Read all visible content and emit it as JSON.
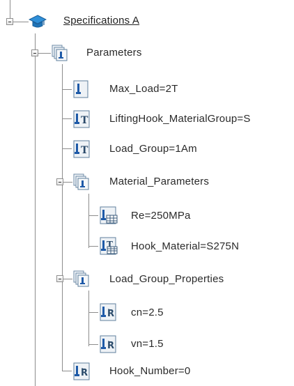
{
  "tree": {
    "root": {
      "label": "Specifications A",
      "icon": "specifications-cap-icon"
    },
    "parameters": {
      "label": "Parameters",
      "icon": "parameter-set-icon"
    },
    "max_load": {
      "label": "Max_Load=2T",
      "icon": "parameter-icon"
    },
    "lifting_hook_material_group": {
      "label": "LiftingHook_MaterialGroup=S",
      "icon": "text-parameter-icon"
    },
    "load_group": {
      "label": "Load_Group=1Am",
      "icon": "text-parameter-icon"
    },
    "material_parameters": {
      "label": "Material_Parameters",
      "icon": "parameter-set-icon"
    },
    "re": {
      "label": "Re=250MPa",
      "icon": "table-parameter-icon"
    },
    "hook_material": {
      "label": "Hook_Material=S275N",
      "icon": "text-table-parameter-icon"
    },
    "load_group_properties": {
      "label": "Load_Group_Properties",
      "icon": "parameter-set-icon"
    },
    "cn": {
      "label": "cn=2.5",
      "icon": "real-parameter-icon"
    },
    "vn": {
      "label": "vn=1.5",
      "icon": "real-parameter-icon"
    },
    "hook_number": {
      "label": "Hook_Number=0",
      "icon": "real-parameter-icon"
    }
  },
  "colors": {
    "tree_line": "#8c8c8c",
    "icon_frame": "#5f7f9c",
    "icon_fill": "#e8edf2",
    "icon_blue": "#1e5aa8",
    "cap_blue": "#2f8fd8"
  }
}
